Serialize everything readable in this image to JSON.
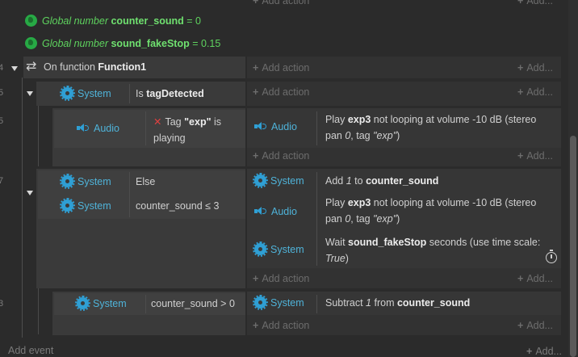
{
  "gutter": {
    "numbers": [
      "4",
      "5",
      "5",
      "7",
      "3"
    ]
  },
  "top_add_action": "Add action",
  "top_add_dots": "Add...",
  "globals": [
    {
      "kind": "Global number",
      "name": "counter_sound",
      "op": "= 0"
    },
    {
      "kind": "Global number",
      "name": "sound_fakeStop",
      "op": "= 0.15"
    }
  ],
  "function": {
    "prefix": "On function",
    "name": "Function1"
  },
  "add_action": "Add action",
  "add_dots": "Add...",
  "event1": {
    "object": "System",
    "cond_prefix": "Is",
    "cond_name": "tagDetected"
  },
  "event1_sub": {
    "object": "Audio",
    "cond_prefix": "Tag",
    "cond_tag": "\"exp\"",
    "cond_suffix": "is",
    "cond_line2": "playing",
    "action_object": "Audio",
    "action_pre": "Play",
    "action_name": "exp3",
    "action_mid": "not looping at volume -10 dB (stereo",
    "action_line2_a": "pan",
    "action_line2_b": "0",
    "action_line2_c": ", tag",
    "action_line2_d": "\"exp\"",
    "action_line2_e": ")"
  },
  "event2": {
    "cond1_object": "System",
    "cond1_text": "Else",
    "cond2_object": "System",
    "cond2_text": "counter_sound ≤ 3",
    "act1_object": "System",
    "act1_a": "Add",
    "act1_b": "1",
    "act1_c": "to",
    "act1_d": "counter_sound",
    "act2_object": "Audio",
    "act2_pre": "Play",
    "act2_name": "exp3",
    "act2_mid": "not looping at volume -10 dB (stereo",
    "act2_l2_a": "pan",
    "act2_l2_b": "0",
    "act2_l2_c": ", tag",
    "act2_l2_d": "\"exp\"",
    "act2_l2_e": ")",
    "act3_object": "System",
    "act3_a": "Wait",
    "act3_b": "sound_fakeStop",
    "act3_c": "seconds (use time scale:",
    "act3_l2": "True",
    "act3_l2_end": ")"
  },
  "event3": {
    "cond_object": "System",
    "cond_text": "counter_sound > 0",
    "act_object": "System",
    "act_a": "Subtract",
    "act_b": "1",
    "act_c": "from",
    "act_d": "counter_sound"
  },
  "footer": {
    "add_event": "Add event",
    "add_dots": "Add..."
  }
}
